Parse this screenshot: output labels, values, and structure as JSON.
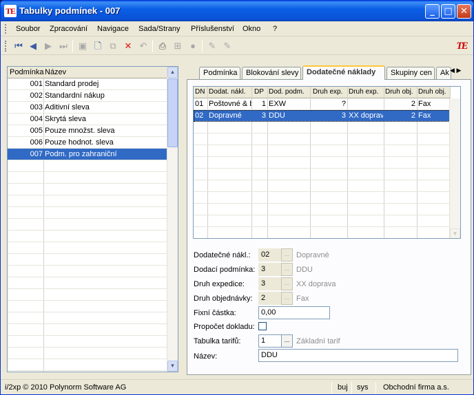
{
  "window": {
    "title": "Tabulky podmínek - 007",
    "app_icon_text": "TE"
  },
  "menu": [
    "Soubor",
    "Zpracování",
    "Navigace",
    "Sada/Strany",
    "Příslušenství",
    "Okno",
    "?"
  ],
  "toolbar": {
    "icons": [
      "first-record-icon",
      "previous-record-icon",
      "next-record-icon",
      "last-record-icon",
      "save-icon",
      "new-icon",
      "copy-icon",
      "delete-icon",
      "undo-icon",
      "print-icon",
      "tree-icon",
      "info-icon",
      "edit-icon",
      "edit-alt-icon"
    ]
  },
  "left_list": {
    "headers": [
      "Podmínka",
      "Název"
    ],
    "rows": [
      {
        "code": "001",
        "name": "Standard prodej"
      },
      {
        "code": "002",
        "name": "Standardní nákup"
      },
      {
        "code": "003",
        "name": "Aditivní sleva"
      },
      {
        "code": "004",
        "name": "Skrytá sleva"
      },
      {
        "code": "005",
        "name": "Pouze množst. sleva"
      },
      {
        "code": "006",
        "name": "Pouze hodnot. sleva"
      },
      {
        "code": "007",
        "name": "Podm. pro zahraniční"
      }
    ],
    "selected_code": "007"
  },
  "tabs": [
    "Podmínka",
    "Blokování slevy",
    "Dodatečné náklady",
    "Skupiny cen",
    "Ak"
  ],
  "active_tab": "Dodatečné náklady",
  "grid": {
    "headers": [
      "DN",
      "Dodat. nákl.",
      "DP",
      "Dod. podm.",
      "Druh exp.",
      "Druh exp.",
      "Druh obj.",
      "Druh obj."
    ],
    "rows": [
      [
        "01",
        "Poštovné & b",
        "1",
        "EXW",
        "?",
        "",
        "2",
        "Fax"
      ],
      [
        "02",
        "Dopravné",
        "3",
        "DDU",
        "3",
        "XX doprav",
        "2",
        "Fax"
      ]
    ],
    "selected_row": 1
  },
  "form": {
    "dodatecne_naklady": {
      "label": "Dodatečné nákl.:",
      "value": "02",
      "desc": "Dopravné"
    },
    "dodaci_podminka": {
      "label": "Dodací podmínka:",
      "value": "3",
      "desc": "DDU"
    },
    "druh_expedice": {
      "label": "Druh expedice:",
      "value": "3",
      "desc": "XX doprava"
    },
    "druh_objednavky": {
      "label": "Druh objednávky:",
      "value": "2",
      "desc": "Fax"
    },
    "fixni_castka": {
      "label": "Fixní částka:",
      "value": "0,00"
    },
    "propocet_dokladu": {
      "label": "Propočet dokladu:",
      "checked": false
    },
    "tabulka_tarifu": {
      "label": "Tabulka tarifů:",
      "value": "1",
      "desc": "Základní tarif"
    },
    "nazev": {
      "label": "Název:",
      "value": "DDU"
    },
    "picker_label": "..."
  },
  "status": {
    "copyright": "i/2xp © 2010 Polynorm Software AG",
    "user": "buj",
    "system": "sys",
    "company": "Obchodní firma a.s."
  },
  "colors": {
    "selection": "#316ac5",
    "titlebar": "#0a5fe6",
    "tab_highlight": "#ffc73c"
  }
}
